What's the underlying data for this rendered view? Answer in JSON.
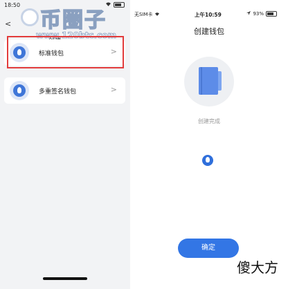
{
  "left": {
    "status_time": "18:50",
    "back_glyph": "<",
    "nav_title": "创建",
    "watermark_big": "币圈子",
    "watermark_url": "www.120btc.com",
    "wallets": [
      {
        "label": "标准钱包",
        "icon": "wallet-drop-icon"
      },
      {
        "label": "多重签名钱包",
        "icon": "multisig-icon"
      }
    ],
    "chevron": ">",
    "highlight_color": "#e23b3b"
  },
  "right": {
    "status_left": "无SIM卡",
    "status_time": "上午10:59",
    "status_battery": "93%",
    "title": "创建钱包",
    "done_text": "创建完成",
    "confirm_label": "确定",
    "corner_watermark": "傻大方",
    "accent": "#3376e5"
  }
}
